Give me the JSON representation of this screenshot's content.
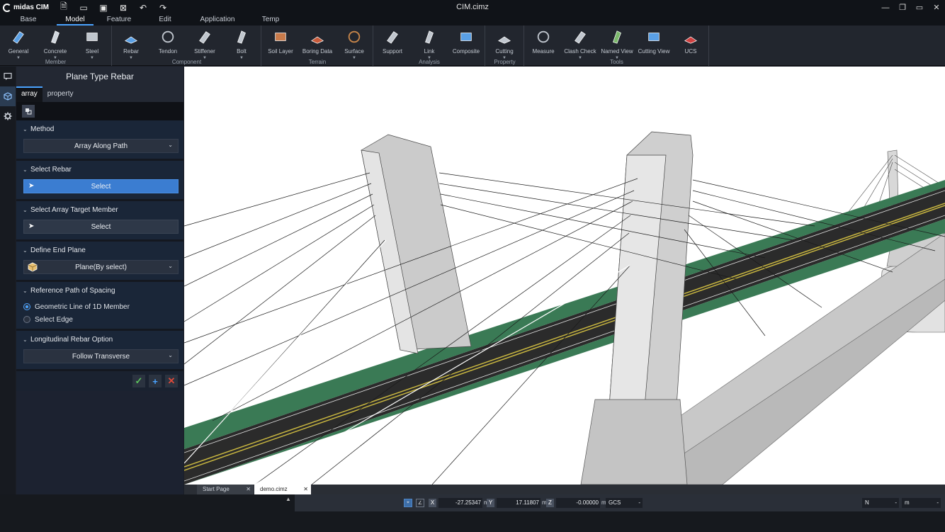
{
  "app": {
    "brand": "midas CIM",
    "title": "CIM.cimz"
  },
  "quick_access": [
    {
      "name": "new-file-icon",
      "glyph": "🗎"
    },
    {
      "name": "open-folder-icon",
      "glyph": "▭"
    },
    {
      "name": "save-icon",
      "glyph": "▣"
    },
    {
      "name": "close-file-icon",
      "glyph": "⊠"
    },
    {
      "name": "undo-icon",
      "glyph": "↶"
    },
    {
      "name": "redo-icon",
      "glyph": "↷"
    }
  ],
  "window_controls": [
    "—",
    "❐",
    "▭",
    "✕"
  ],
  "menu_tabs": [
    {
      "label": "Base",
      "active": false
    },
    {
      "label": "Model",
      "active": true
    },
    {
      "label": "Feature",
      "active": false
    },
    {
      "label": "Edit",
      "active": false
    },
    {
      "label": "Application",
      "active": false
    },
    {
      "label": "Temp",
      "active": false
    }
  ],
  "ribbon": {
    "groups": [
      {
        "label": "Member",
        "buttons": [
          {
            "label": "General",
            "icon": "general-member-icon",
            "color": "#5aa0e6",
            "dropdown": true
          },
          {
            "label": "Concrete",
            "icon": "concrete-member-icon",
            "color": "#d0d6de",
            "dropdown": true
          },
          {
            "label": "Steel",
            "icon": "steel-member-icon",
            "color": "#c0c6ce",
            "dropdown": true
          }
        ]
      },
      {
        "label": "Component",
        "buttons": [
          {
            "label": "Rebar",
            "icon": "rebar-icon",
            "color": "#5aa0e6",
            "dropdown": true
          },
          {
            "label": "Tendon",
            "icon": "tendon-icon",
            "color": "#c0c6ce",
            "dropdown": false
          },
          {
            "label": "Stiffener",
            "icon": "stiffener-icon",
            "color": "#c0c6ce",
            "dropdown": true
          },
          {
            "label": "Bolt",
            "icon": "bolt-icon",
            "color": "#c0c6ce",
            "dropdown": true
          }
        ]
      },
      {
        "label": "Terrain",
        "buttons": [
          {
            "label": "Soil Layer",
            "icon": "soil-layer-icon",
            "color": "#c87a4a",
            "dropdown": false
          },
          {
            "label": "Boring Data",
            "icon": "boring-data-icon",
            "color": "#c85a3a",
            "dropdown": false
          },
          {
            "label": "Surface",
            "icon": "surface-icon",
            "color": "#c8864a",
            "dropdown": true
          }
        ]
      },
      {
        "label": "Analysis",
        "buttons": [
          {
            "label": "Support",
            "icon": "support-icon",
            "color": "#c0c6ce",
            "dropdown": false
          },
          {
            "label": "Link",
            "icon": "link-icon",
            "color": "#c0c6ce",
            "dropdown": true
          },
          {
            "label": "Composite",
            "icon": "composite-icon",
            "color": "#5aa0e6",
            "dropdown": false
          }
        ]
      },
      {
        "label": "Property",
        "buttons": [
          {
            "label": "Cutting",
            "icon": "cutting-icon",
            "color": "#c0c6ce",
            "dropdown": true
          }
        ]
      },
      {
        "label": "Tools",
        "buttons": [
          {
            "label": "Measure",
            "icon": "measure-icon",
            "color": "#c0c6ce",
            "dropdown": false
          },
          {
            "label": "Clash Check",
            "icon": "clash-check-icon",
            "color": "#c0c6ce",
            "dropdown": true
          },
          {
            "label": "Named View",
            "icon": "named-view-icon",
            "color": "#7ab86a",
            "dropdown": true
          },
          {
            "label": "Cutting View",
            "icon": "cutting-view-icon",
            "color": "#5aa0e6",
            "dropdown": false
          },
          {
            "label": "UCS",
            "icon": "ucs-icon",
            "color": "#d04040",
            "dropdown": false
          }
        ]
      }
    ]
  },
  "panel": {
    "title": "Plane Type Rebar",
    "tabs": [
      {
        "label": "array",
        "active": true
      },
      {
        "label": "property",
        "active": false
      }
    ],
    "sections": {
      "method": {
        "title": "Method",
        "value": "Array Along Path"
      },
      "select_rebar": {
        "title": "Select Rebar",
        "button": "Select"
      },
      "select_target": {
        "title": "Select Array Target Member",
        "button": "Select"
      },
      "end_plane": {
        "title": "Define End Plane",
        "value": "Plane(By select)"
      },
      "ref_path": {
        "title": "Reference Path of Spacing",
        "options": [
          {
            "label": "Geometric Line of 1D Member",
            "selected": true
          },
          {
            "label": "Select Edge",
            "selected": false
          }
        ]
      },
      "long_rebar": {
        "title": "Longitudinal Rebar Option",
        "value": "Follow Transverse"
      }
    },
    "actions": [
      {
        "name": "confirm-icon",
        "glyph": "✓",
        "color": "#5cc15c"
      },
      {
        "name": "apply-icon",
        "glyph": "+",
        "color": "#4aa3ff"
      },
      {
        "name": "cancel-icon",
        "glyph": "✕",
        "color": "#e04a3a"
      }
    ]
  },
  "doc_tabs": [
    {
      "label": "Start Page",
      "active": false
    },
    {
      "label": "demo.cimz",
      "active": true
    }
  ],
  "status": {
    "x": "-27.25347",
    "y": "17.11807",
    "z": "-0.00000",
    "unit": "m",
    "coord_system": "GCS",
    "force_unit": "N",
    "length_unit": "m"
  }
}
